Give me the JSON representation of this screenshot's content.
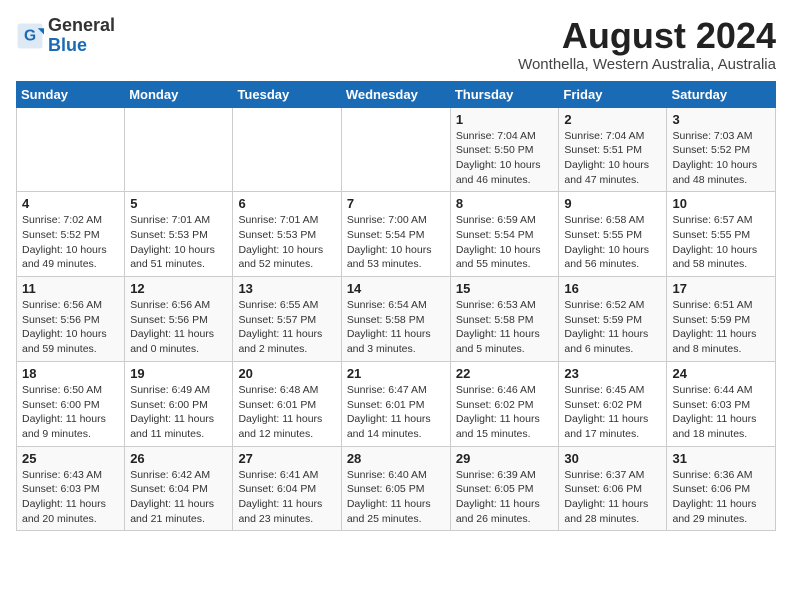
{
  "logo": {
    "general": "General",
    "blue": "Blue"
  },
  "title": "August 2024",
  "subtitle": "Wonthella, Western Australia, Australia",
  "days_header": [
    "Sunday",
    "Monday",
    "Tuesday",
    "Wednesday",
    "Thursday",
    "Friday",
    "Saturday"
  ],
  "weeks": [
    [
      {
        "num": "",
        "detail": ""
      },
      {
        "num": "",
        "detail": ""
      },
      {
        "num": "",
        "detail": ""
      },
      {
        "num": "",
        "detail": ""
      },
      {
        "num": "1",
        "detail": "Sunrise: 7:04 AM\nSunset: 5:50 PM\nDaylight: 10 hours\nand 46 minutes."
      },
      {
        "num": "2",
        "detail": "Sunrise: 7:04 AM\nSunset: 5:51 PM\nDaylight: 10 hours\nand 47 minutes."
      },
      {
        "num": "3",
        "detail": "Sunrise: 7:03 AM\nSunset: 5:52 PM\nDaylight: 10 hours\nand 48 minutes."
      }
    ],
    [
      {
        "num": "4",
        "detail": "Sunrise: 7:02 AM\nSunset: 5:52 PM\nDaylight: 10 hours\nand 49 minutes."
      },
      {
        "num": "5",
        "detail": "Sunrise: 7:01 AM\nSunset: 5:53 PM\nDaylight: 10 hours\nand 51 minutes."
      },
      {
        "num": "6",
        "detail": "Sunrise: 7:01 AM\nSunset: 5:53 PM\nDaylight: 10 hours\nand 52 minutes."
      },
      {
        "num": "7",
        "detail": "Sunrise: 7:00 AM\nSunset: 5:54 PM\nDaylight: 10 hours\nand 53 minutes."
      },
      {
        "num": "8",
        "detail": "Sunrise: 6:59 AM\nSunset: 5:54 PM\nDaylight: 10 hours\nand 55 minutes."
      },
      {
        "num": "9",
        "detail": "Sunrise: 6:58 AM\nSunset: 5:55 PM\nDaylight: 10 hours\nand 56 minutes."
      },
      {
        "num": "10",
        "detail": "Sunrise: 6:57 AM\nSunset: 5:55 PM\nDaylight: 10 hours\nand 58 minutes."
      }
    ],
    [
      {
        "num": "11",
        "detail": "Sunrise: 6:56 AM\nSunset: 5:56 PM\nDaylight: 10 hours\nand 59 minutes."
      },
      {
        "num": "12",
        "detail": "Sunrise: 6:56 AM\nSunset: 5:56 PM\nDaylight: 11 hours\nand 0 minutes."
      },
      {
        "num": "13",
        "detail": "Sunrise: 6:55 AM\nSunset: 5:57 PM\nDaylight: 11 hours\nand 2 minutes."
      },
      {
        "num": "14",
        "detail": "Sunrise: 6:54 AM\nSunset: 5:58 PM\nDaylight: 11 hours\nand 3 minutes."
      },
      {
        "num": "15",
        "detail": "Sunrise: 6:53 AM\nSunset: 5:58 PM\nDaylight: 11 hours\nand 5 minutes."
      },
      {
        "num": "16",
        "detail": "Sunrise: 6:52 AM\nSunset: 5:59 PM\nDaylight: 11 hours\nand 6 minutes."
      },
      {
        "num": "17",
        "detail": "Sunrise: 6:51 AM\nSunset: 5:59 PM\nDaylight: 11 hours\nand 8 minutes."
      }
    ],
    [
      {
        "num": "18",
        "detail": "Sunrise: 6:50 AM\nSunset: 6:00 PM\nDaylight: 11 hours\nand 9 minutes."
      },
      {
        "num": "19",
        "detail": "Sunrise: 6:49 AM\nSunset: 6:00 PM\nDaylight: 11 hours\nand 11 minutes."
      },
      {
        "num": "20",
        "detail": "Sunrise: 6:48 AM\nSunset: 6:01 PM\nDaylight: 11 hours\nand 12 minutes."
      },
      {
        "num": "21",
        "detail": "Sunrise: 6:47 AM\nSunset: 6:01 PM\nDaylight: 11 hours\nand 14 minutes."
      },
      {
        "num": "22",
        "detail": "Sunrise: 6:46 AM\nSunset: 6:02 PM\nDaylight: 11 hours\nand 15 minutes."
      },
      {
        "num": "23",
        "detail": "Sunrise: 6:45 AM\nSunset: 6:02 PM\nDaylight: 11 hours\nand 17 minutes."
      },
      {
        "num": "24",
        "detail": "Sunrise: 6:44 AM\nSunset: 6:03 PM\nDaylight: 11 hours\nand 18 minutes."
      }
    ],
    [
      {
        "num": "25",
        "detail": "Sunrise: 6:43 AM\nSunset: 6:03 PM\nDaylight: 11 hours\nand 20 minutes."
      },
      {
        "num": "26",
        "detail": "Sunrise: 6:42 AM\nSunset: 6:04 PM\nDaylight: 11 hours\nand 21 minutes."
      },
      {
        "num": "27",
        "detail": "Sunrise: 6:41 AM\nSunset: 6:04 PM\nDaylight: 11 hours\nand 23 minutes."
      },
      {
        "num": "28",
        "detail": "Sunrise: 6:40 AM\nSunset: 6:05 PM\nDaylight: 11 hours\nand 25 minutes."
      },
      {
        "num": "29",
        "detail": "Sunrise: 6:39 AM\nSunset: 6:05 PM\nDaylight: 11 hours\nand 26 minutes."
      },
      {
        "num": "30",
        "detail": "Sunrise: 6:37 AM\nSunset: 6:06 PM\nDaylight: 11 hours\nand 28 minutes."
      },
      {
        "num": "31",
        "detail": "Sunrise: 6:36 AM\nSunset: 6:06 PM\nDaylight: 11 hours\nand 29 minutes."
      }
    ]
  ]
}
